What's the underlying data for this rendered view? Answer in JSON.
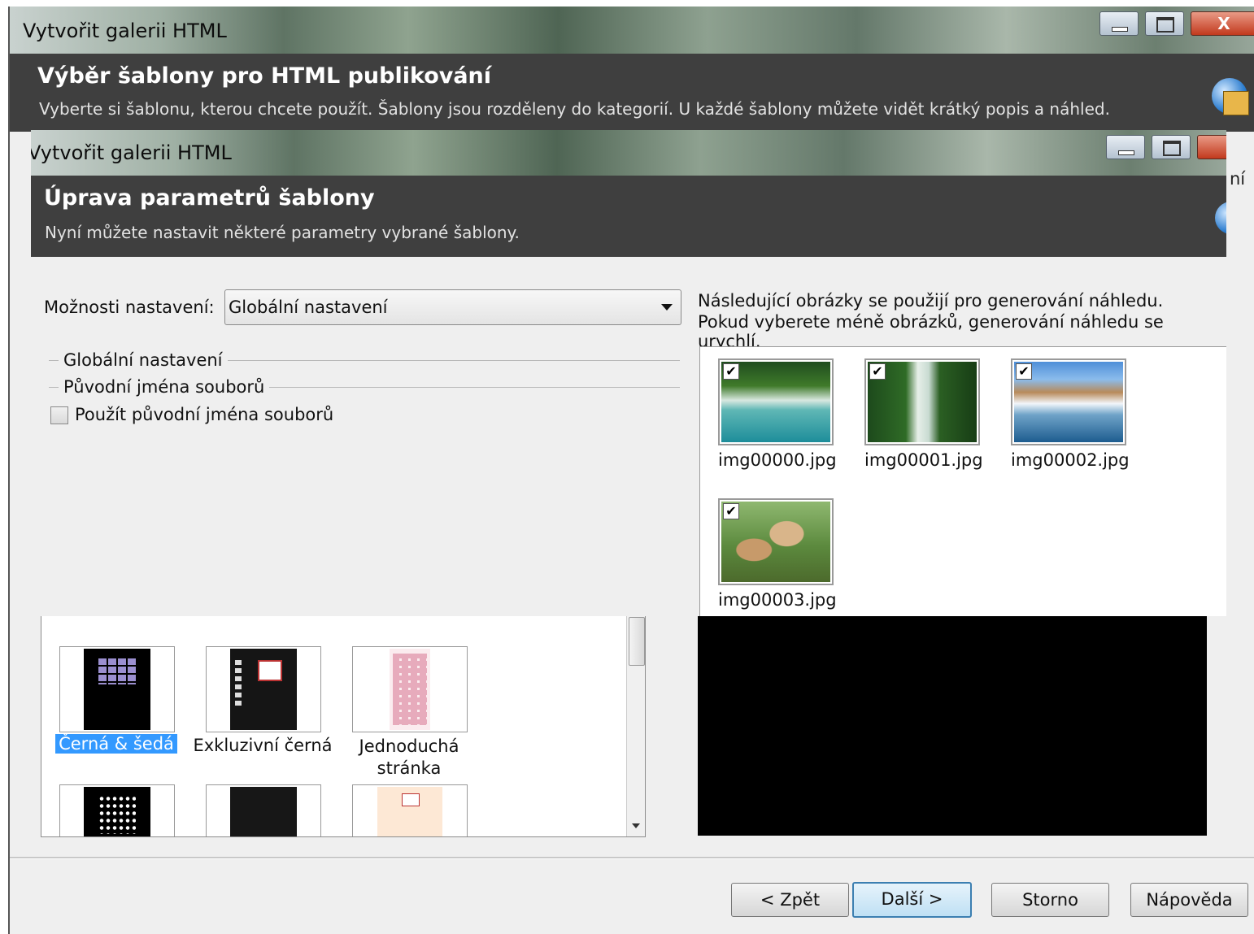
{
  "outer_window": {
    "title": "Vytvořit galerii HTML",
    "header_title": "Výběr šablony pro HTML publikování",
    "header_subtitle": "Vyberte si šablonu, kterou chcete použít. Šablony jsou rozděleny do kategorií. U každé šablony můžete vidět krátký popis a náhled.",
    "peek_text": "ní",
    "close_glyph": "X"
  },
  "inner_window": {
    "title": "Vytvořit galerii HTML",
    "header_title": "Úprava parametrů šablony",
    "header_subtitle": "Nyní můžete nastavit některé parametry vybrané šablony."
  },
  "settings": {
    "label": "Možnosti nastavení:",
    "selected": "Globální nastavení",
    "group_global": "Globální nastavení",
    "group_filenames": "Původní jména souborů",
    "checkbox_label": "Použít původní jména souborů",
    "checkbox_checked": false
  },
  "preview_info": {
    "line1": "Následující obrázky se použijí pro generování náhledu.",
    "line2": "Pokud vyberete méně obrázků, generování náhledu se urychlí."
  },
  "images": [
    {
      "name": "img00000.jpg",
      "checked": true
    },
    {
      "name": "img00001.jpg",
      "checked": true
    },
    {
      "name": "img00002.jpg",
      "checked": true
    },
    {
      "name": "img00003.jpg",
      "checked": true
    }
  ],
  "templates": [
    {
      "name": "Černá & šedá",
      "selected": true
    },
    {
      "name": "Exkluzivní černá",
      "selected": false
    },
    {
      "name": "Jednoduchá stránka",
      "selected": false
    }
  ],
  "buttons": {
    "back": "< Zpět",
    "next": "Další >",
    "cancel": "Storno",
    "help": "Nápověda"
  },
  "checkmark_glyph": "✔",
  "colors": {
    "header_bg": "#3f3f3f",
    "dialog_bg": "#efefef",
    "selection": "#3399ff",
    "preview_bg": "#000000"
  }
}
